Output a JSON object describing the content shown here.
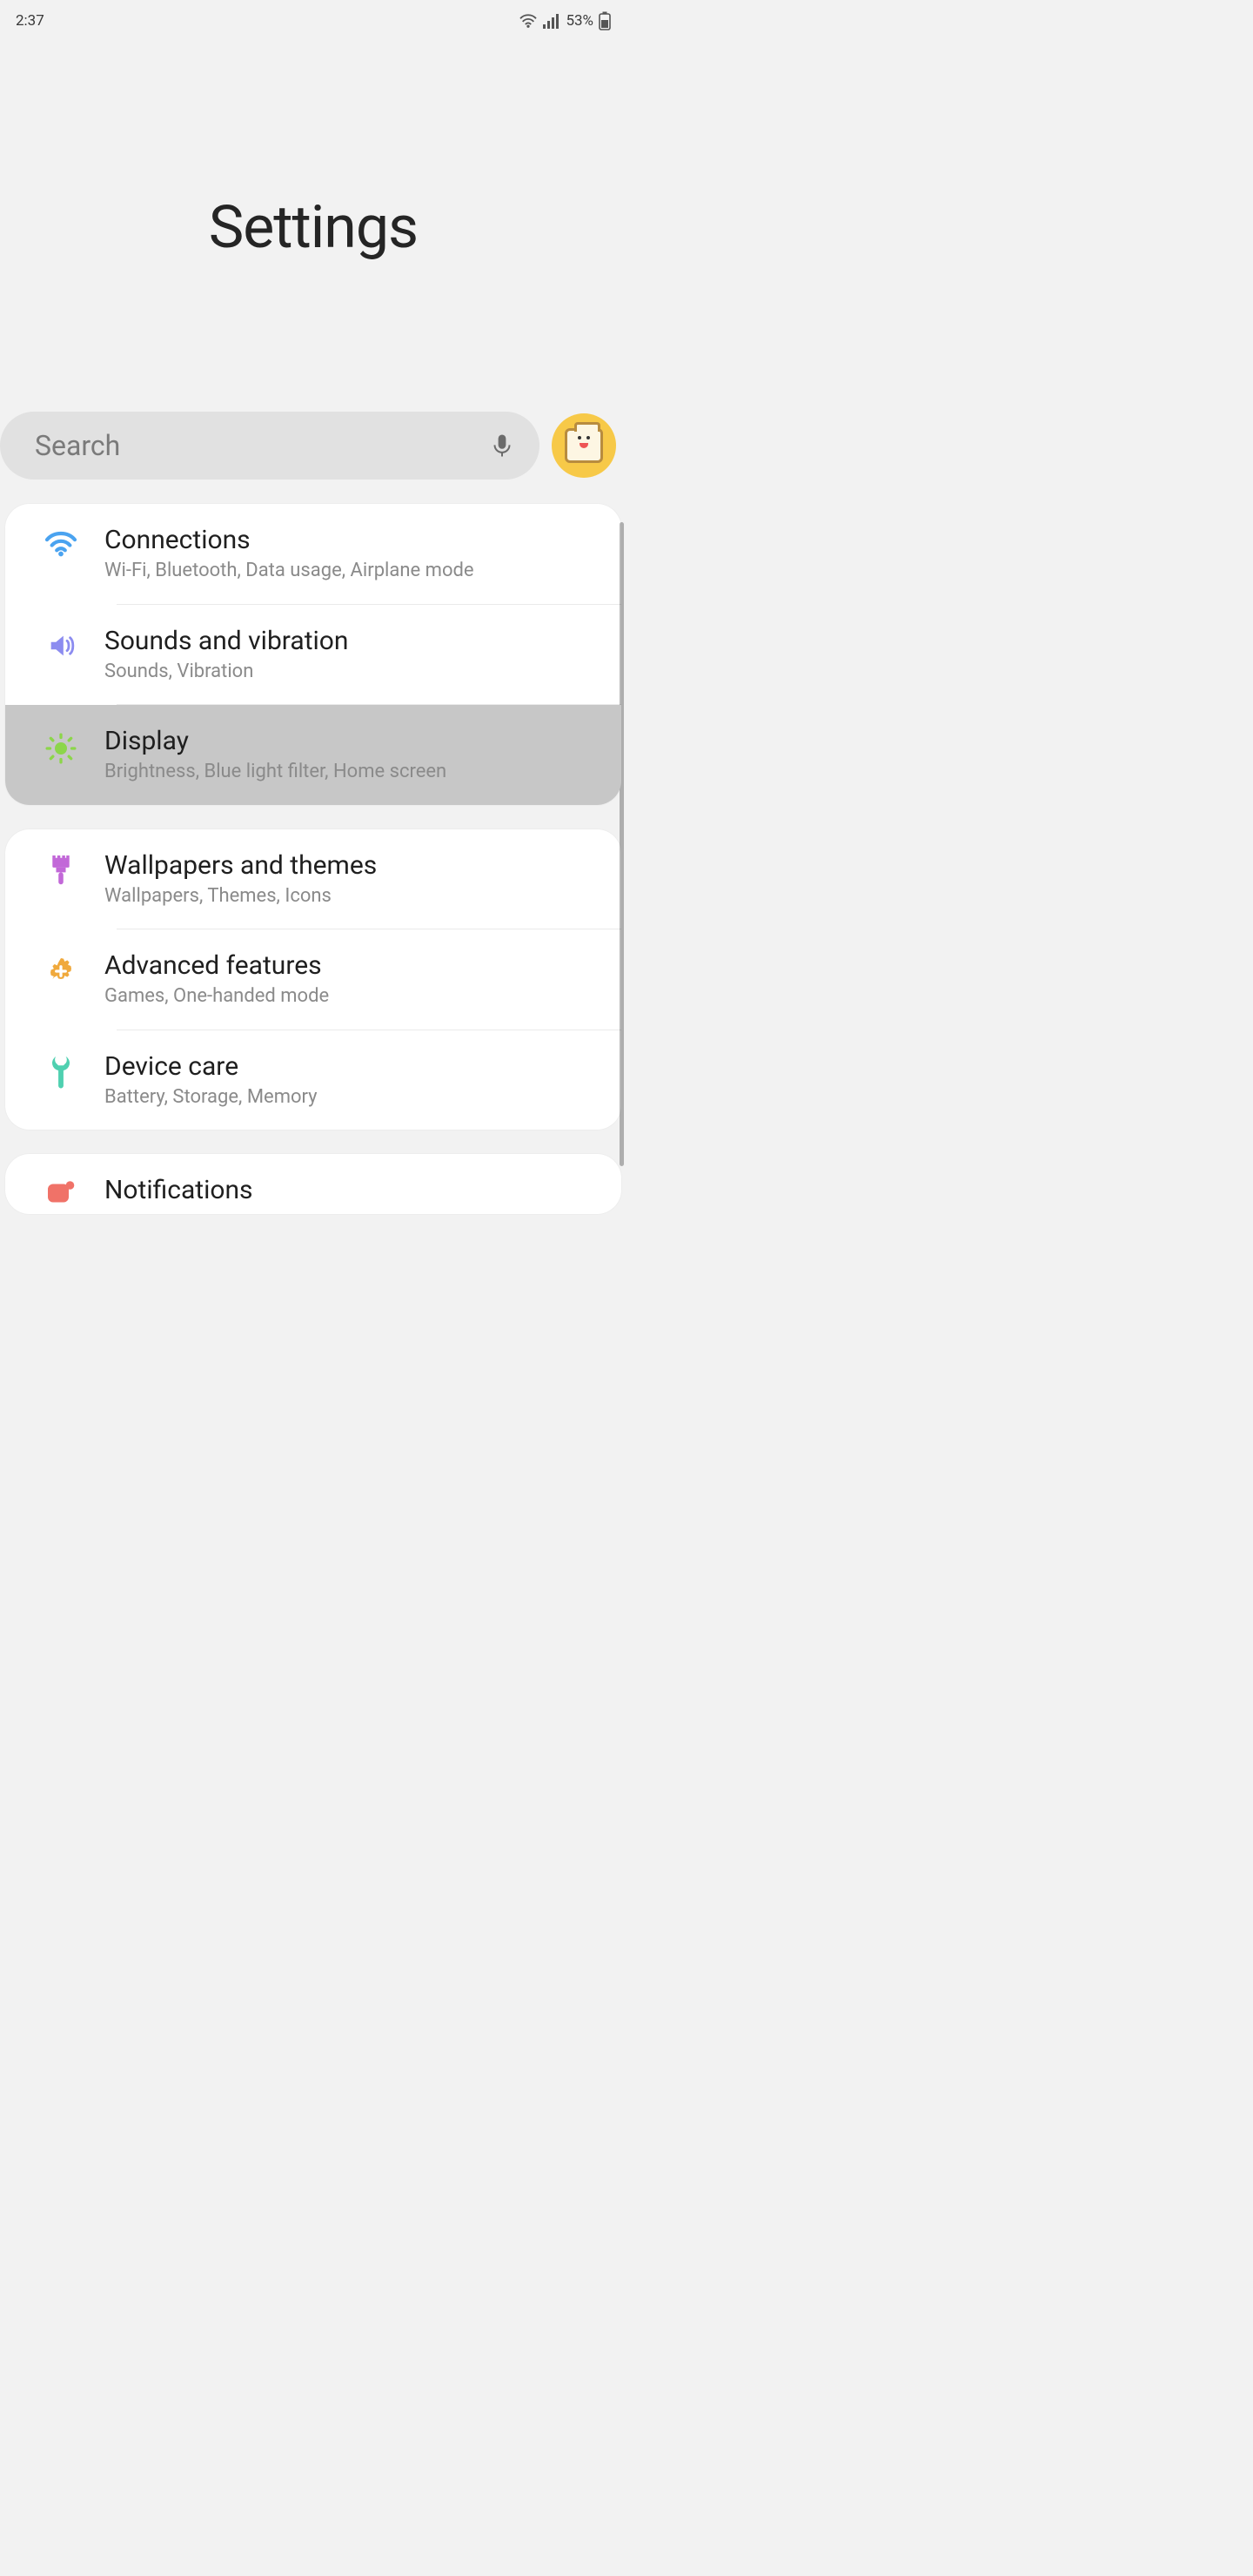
{
  "status": {
    "time": "2:37",
    "battery_pct": "53%"
  },
  "hero": {
    "title": "Settings"
  },
  "search": {
    "placeholder": "Search"
  },
  "groups": [
    {
      "rows": [
        {
          "id": "connections",
          "title": "Connections",
          "sub": "Wi-Fi, Bluetooth, Data usage, Airplane mode",
          "pressed": false
        },
        {
          "id": "sounds",
          "title": "Sounds and vibration",
          "sub": "Sounds, Vibration",
          "pressed": false
        },
        {
          "id": "display",
          "title": "Display",
          "sub": "Brightness, Blue light filter, Home screen",
          "pressed": true
        }
      ]
    },
    {
      "rows": [
        {
          "id": "wallpapers",
          "title": "Wallpapers and themes",
          "sub": "Wallpapers, Themes, Icons",
          "pressed": false
        },
        {
          "id": "advanced",
          "title": "Advanced features",
          "sub": "Games, One-handed mode",
          "pressed": false
        },
        {
          "id": "devicecare",
          "title": "Device care",
          "sub": "Battery, Storage, Memory",
          "pressed": false
        }
      ]
    },
    {
      "rows": [
        {
          "id": "notifications",
          "title": "Notifications",
          "sub": "",
          "pressed": false
        }
      ]
    }
  ]
}
